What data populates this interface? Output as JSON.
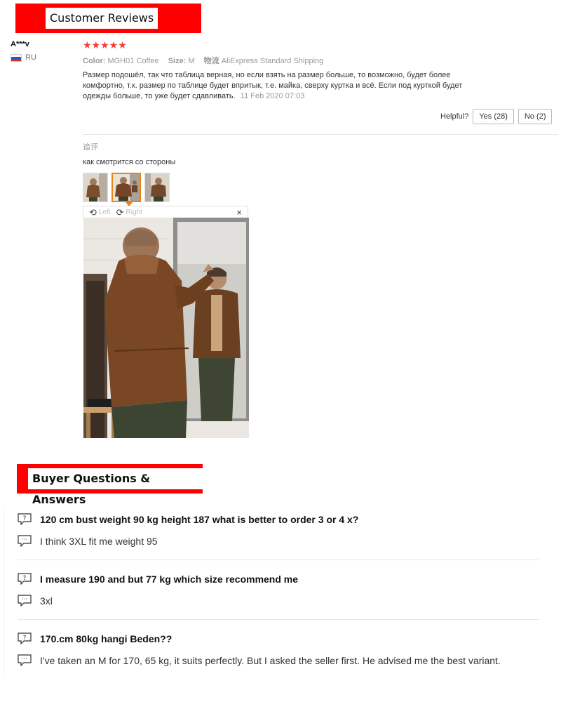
{
  "sections": {
    "reviews_title": "Customer Reviews",
    "qa_title": "Buyer Questions & Answers"
  },
  "review": {
    "reviewer_name": "A***v",
    "country": "RU",
    "stars": "★★★★★",
    "rating": 5,
    "color_key": "Color:",
    "color_value": "MGH01 Coffee",
    "size_key": "Size:",
    "size_value": "M",
    "shipping_key": "物流",
    "shipping_value": "AliExpress Standard Shipping",
    "text": "Размер подошёл, так что таблица верная, но если взять на размер больше, то возможно, будет более комфортно, т.к. размер по таблице будет впритык, т.е. майка, сверху куртка и всё. Если под курткой будет одежды больше, то уже будет сдавливать.",
    "date": "11 Feb 2020 07:03",
    "helpful_label": "Helpful?",
    "yes_label": "Yes (28)",
    "no_label": "No (2)",
    "followup_label": "追评",
    "followup_text": "как смотрится со стороны",
    "viewer": {
      "left_label": "Left",
      "right_label": "Right",
      "close_label": "×"
    },
    "colors": {
      "stars": "#f23c3c",
      "banner": "#ff0000",
      "active_thumb": "#e8841a"
    }
  },
  "qa": [
    {
      "question": "120 cm bust weight 90 kg height 187 what is better to order 3 or 4 x?",
      "answer": "I think 3XL fit me weight 95"
    },
    {
      "question": "I measure 190 and but 77 kg which size recommend me",
      "answer": "3xl"
    },
    {
      "question": "170.cm 80kg hangi Beden??",
      "answer": "I've taken an M for 170, 65 kg, it suits perfectly. But I asked the seller first. He advised me the best variant."
    }
  ]
}
